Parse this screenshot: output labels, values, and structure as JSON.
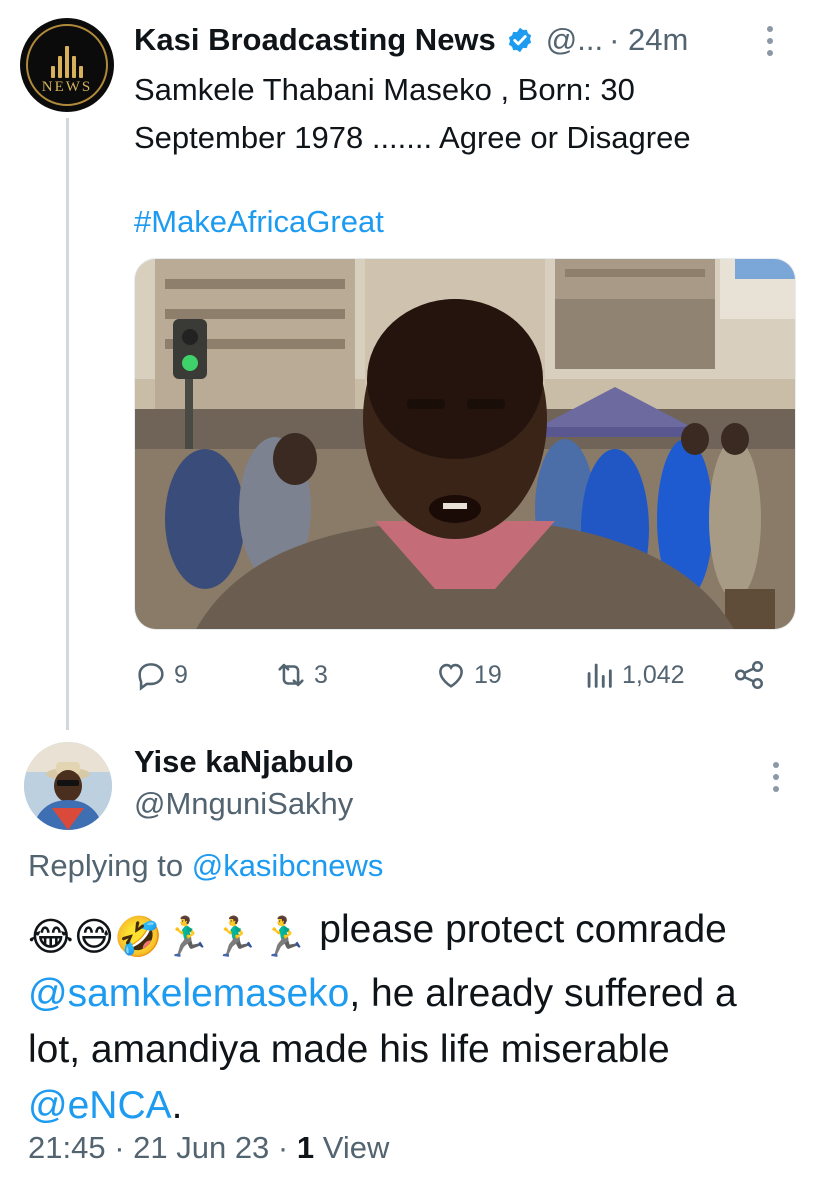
{
  "tweet": {
    "display_name": "Kasi Broadcasting News",
    "handle": "@...",
    "time": "· 24m",
    "text_line1": "Samkele Thabani Maseko , Born: 30",
    "text_line2": "September 1978 ....... Agree or Disagree",
    "hashtag": "#MakeAfricaGreat",
    "avatar_logo_text": "NEWS",
    "stats": {
      "replies": "9",
      "retweets": "3",
      "likes": "19",
      "views": "1,042"
    },
    "colors": {
      "link": "#1d9bf0",
      "verified": "#1d9bf0",
      "muted": "#536471"
    }
  },
  "reply": {
    "display_name": "Yise kaNjabulo",
    "handle": "@MnguniSakhy",
    "replying_label": "Replying to",
    "replying_handle": "@kasibcnews",
    "emoji_line": "😂😅🤣🏃‍♂️🏃‍♂️🏃‍♂️",
    "text_part1": " please protect comrade ",
    "mention1": "@samkelemaseko",
    "text_part2": ", he already suffered a lot, amandiya made his life miserable ",
    "mention2": "@eNCA",
    "text_part3": ".",
    "time": "21:45 · 21 Jun 23 ·",
    "views_count": "1",
    "views_label": "View"
  }
}
